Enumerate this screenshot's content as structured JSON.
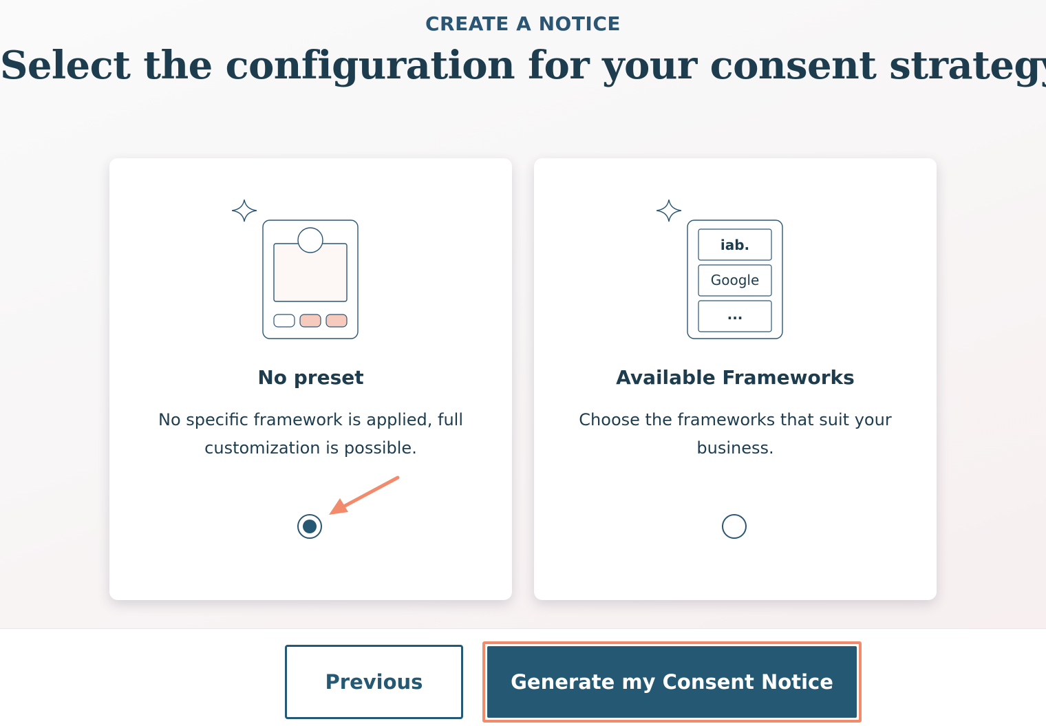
{
  "header": {
    "eyebrow": "CREATE A NOTICE",
    "title": "Select the configuration for your consent strategy"
  },
  "options": [
    {
      "title": "No preset",
      "description": "No specific framework is applied, full customization is possible.",
      "selected": true
    },
    {
      "title": "Available Frameworks",
      "description": "Choose the frameworks that suit your business.",
      "selected": false,
      "frameworks": [
        "iab.",
        "Google",
        "..."
      ]
    }
  ],
  "footer": {
    "previous_label": "Previous",
    "generate_label": "Generate my Consent Notice"
  },
  "colors": {
    "primary": "#245873",
    "text": "#1d3d4f",
    "highlight": "#f28b6b",
    "accent_soft": "#f6cbbd"
  },
  "icons": [
    "sparkle-icon",
    "arrow-annotation-icon"
  ]
}
